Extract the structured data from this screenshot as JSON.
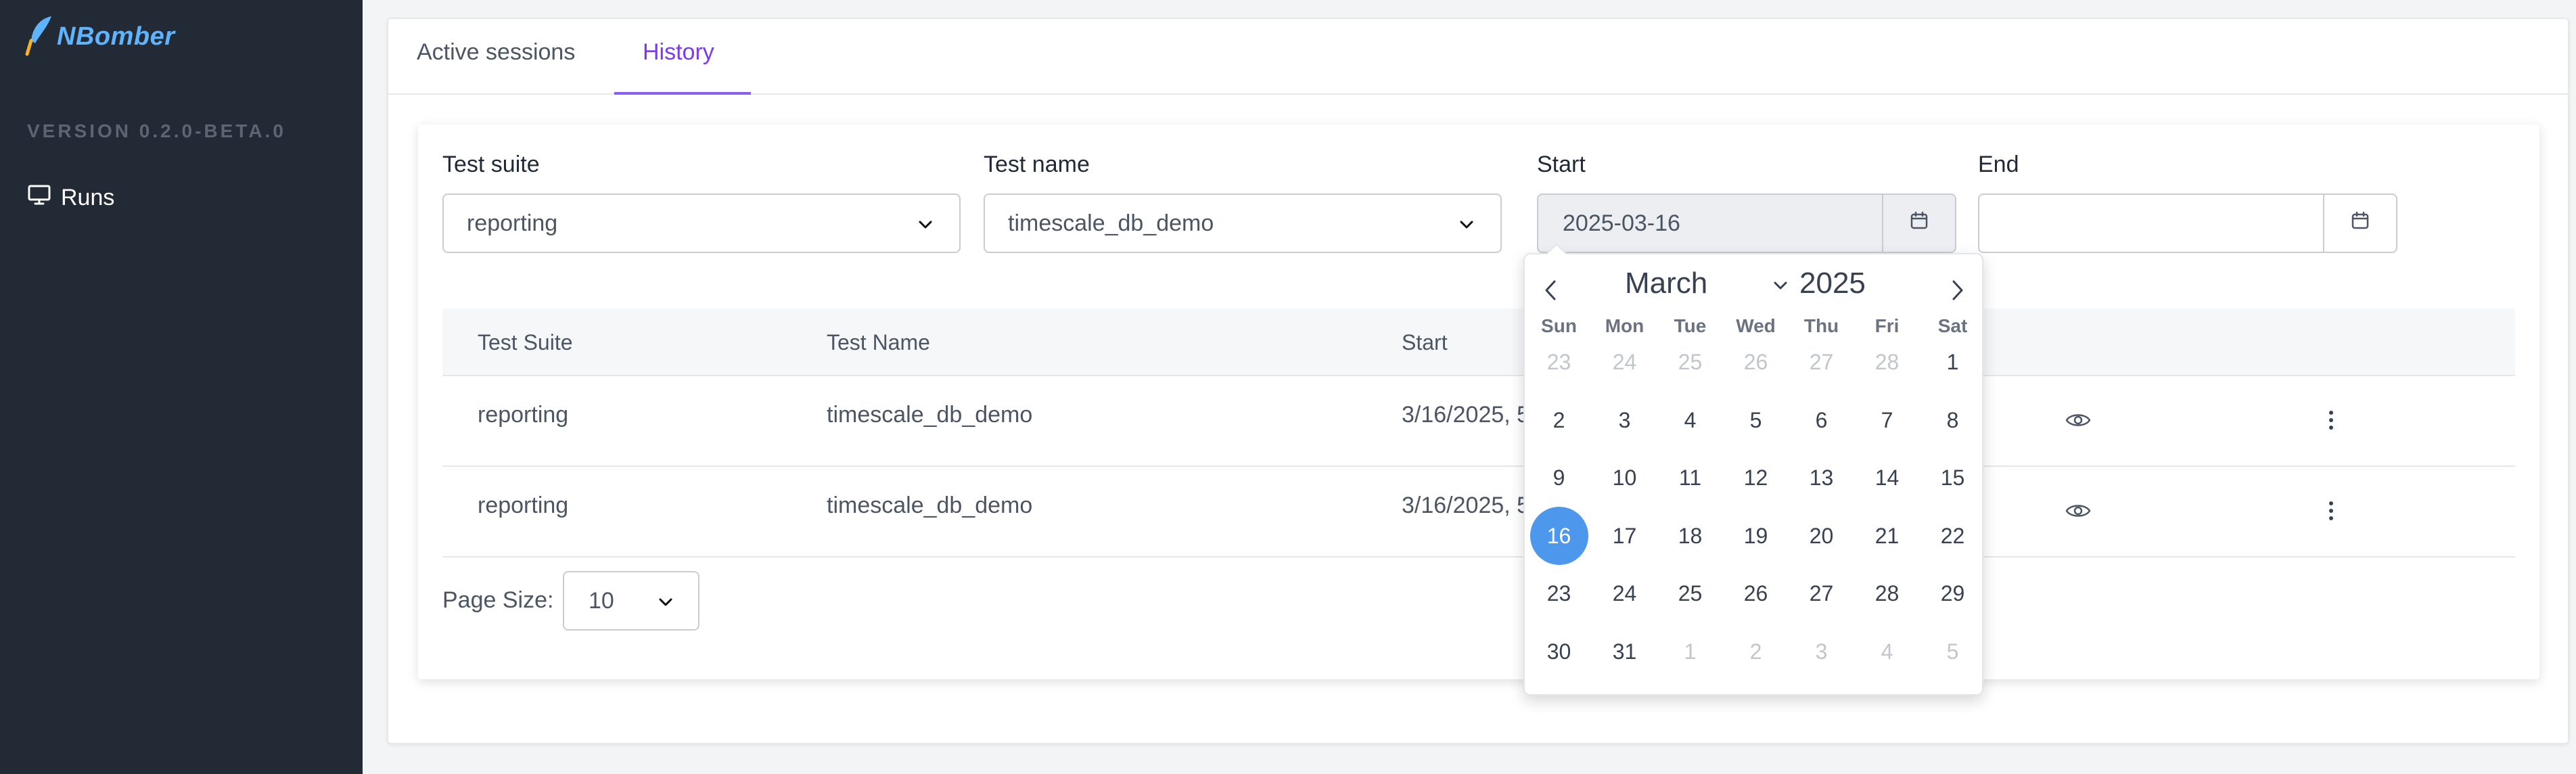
{
  "app": {
    "name": "NBomber",
    "version": "VERSION 0.2.0-BETA.0",
    "brand_color": "#5fb4ff",
    "accent_color": "#8b5cf6"
  },
  "sidebar": {
    "items": [
      {
        "label": "Runs",
        "icon": "monitor-icon"
      }
    ]
  },
  "tabs": [
    {
      "label": "Active sessions",
      "active": false
    },
    {
      "label": "History",
      "active": true
    }
  ],
  "filters": {
    "test_suite": {
      "label": "Test suite",
      "value": "reporting"
    },
    "test_name": {
      "label": "Test name",
      "value": "timescale_db_demo"
    },
    "start": {
      "label": "Start",
      "value": "2025-03-16"
    },
    "end": {
      "label": "End",
      "value": ""
    }
  },
  "table": {
    "columns": [
      "Test Suite",
      "Test Name",
      "Start"
    ],
    "rows": [
      {
        "suite": "reporting",
        "name": "timescale_db_demo",
        "start": "3/16/2025, 5"
      },
      {
        "suite": "reporting",
        "name": "timescale_db_demo",
        "start": "3/16/2025, 5"
      }
    ]
  },
  "pagination": {
    "label": "Page Size:",
    "value": "10"
  },
  "datepicker": {
    "month": "March",
    "year": "2025",
    "weekdays": [
      "Sun",
      "Mon",
      "Tue",
      "Wed",
      "Thu",
      "Fri",
      "Sat"
    ],
    "selected_day": "16",
    "weeks": [
      [
        {
          "d": "23",
          "m": true
        },
        {
          "d": "24",
          "m": true
        },
        {
          "d": "25",
          "m": true
        },
        {
          "d": "26",
          "m": true
        },
        {
          "d": "27",
          "m": true
        },
        {
          "d": "28",
          "m": true
        },
        {
          "d": "1",
          "m": false
        }
      ],
      [
        {
          "d": "2",
          "m": false
        },
        {
          "d": "3",
          "m": false
        },
        {
          "d": "4",
          "m": false
        },
        {
          "d": "5",
          "m": false
        },
        {
          "d": "6",
          "m": false
        },
        {
          "d": "7",
          "m": false
        },
        {
          "d": "8",
          "m": false
        }
      ],
      [
        {
          "d": "9",
          "m": false
        },
        {
          "d": "10",
          "m": false
        },
        {
          "d": "11",
          "m": false
        },
        {
          "d": "12",
          "m": false
        },
        {
          "d": "13",
          "m": false
        },
        {
          "d": "14",
          "m": false
        },
        {
          "d": "15",
          "m": false
        }
      ],
      [
        {
          "d": "16",
          "m": false
        },
        {
          "d": "17",
          "m": false
        },
        {
          "d": "18",
          "m": false
        },
        {
          "d": "19",
          "m": false
        },
        {
          "d": "20",
          "m": false
        },
        {
          "d": "21",
          "m": false
        },
        {
          "d": "22",
          "m": false
        }
      ],
      [
        {
          "d": "23",
          "m": false
        },
        {
          "d": "24",
          "m": false
        },
        {
          "d": "25",
          "m": false
        },
        {
          "d": "26",
          "m": false
        },
        {
          "d": "27",
          "m": false
        },
        {
          "d": "28",
          "m": false
        },
        {
          "d": "29",
          "m": false
        }
      ],
      [
        {
          "d": "30",
          "m": false
        },
        {
          "d": "31",
          "m": false
        },
        {
          "d": "1",
          "m": true
        },
        {
          "d": "2",
          "m": true
        },
        {
          "d": "3",
          "m": true
        },
        {
          "d": "4",
          "m": true
        },
        {
          "d": "5",
          "m": true
        }
      ]
    ],
    "selected_color": "#4d97ec"
  }
}
